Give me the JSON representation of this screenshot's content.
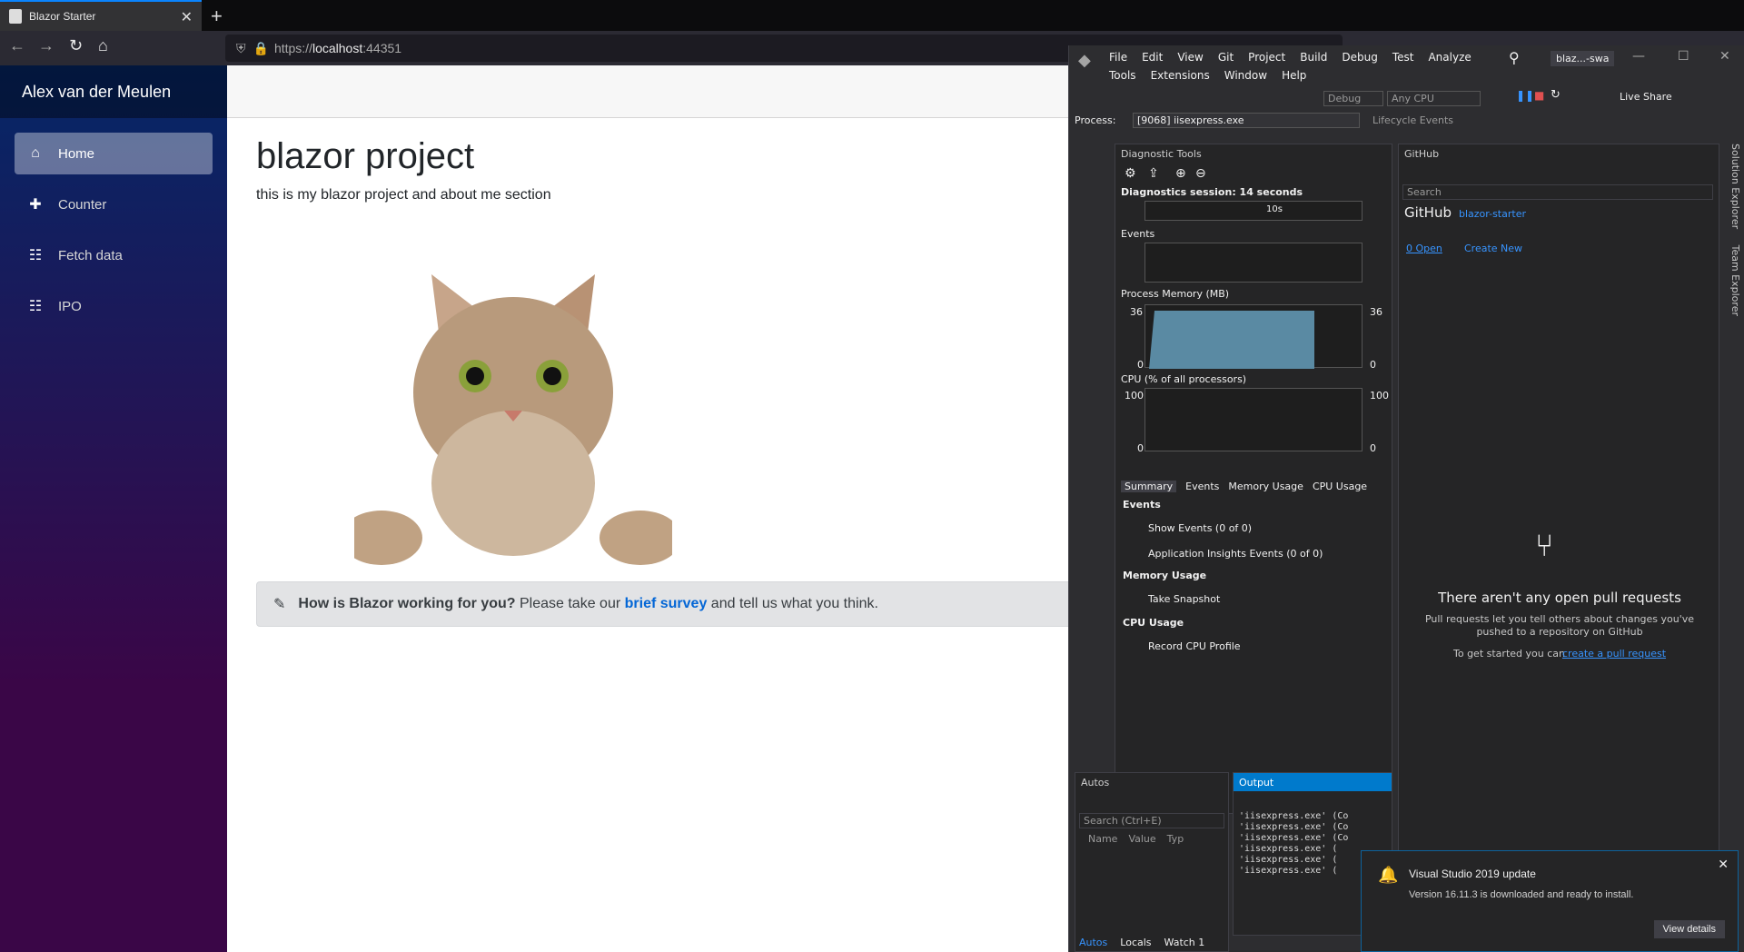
{
  "browser": {
    "tab_title": "Blazor Starter",
    "url_scheme": "https://",
    "url_host": "localhost",
    "url_port": ":44351"
  },
  "sidebar": {
    "brand": "Alex van der Meulen",
    "items": [
      {
        "label": "Home",
        "icon": "home-icon",
        "active": true
      },
      {
        "label": "Counter",
        "icon": "plus-icon",
        "active": false
      },
      {
        "label": "Fetch data",
        "icon": "list-icon",
        "active": false
      },
      {
        "label": "IPO",
        "icon": "list-icon",
        "active": false
      }
    ]
  },
  "main": {
    "title": "blazor project",
    "subtitle": "this is my blazor project and about me section",
    "survey_bold": "How is Blazor working for you?",
    "survey_text_1": "Please take our",
    "survey_link": "brief survey",
    "survey_text_2": "and tell us what you think."
  },
  "vs": {
    "menu_row1": [
      "File",
      "Edit",
      "View",
      "Git",
      "Project",
      "Build",
      "Debug",
      "Test",
      "Analyze"
    ],
    "menu_row2": [
      "Tools",
      "Extensions",
      "Window",
      "Help"
    ],
    "solution": "blaz...-swa",
    "process_label": "Process:",
    "process_value": "[9068] iisexpress.exe",
    "lifecycle": "Lifecycle Events",
    "debug_config": "Debug",
    "platform": "Any CPU",
    "live_share": "Live Share",
    "diag": {
      "title": "Diagnostic Tools",
      "session": "Diagnostics session: 14 seconds",
      "timeline_tick": "10s",
      "events_label": "Events",
      "memory_label": "Process Memory (MB)",
      "memory_max": "36",
      "memory_min": "0",
      "cpu_label": "CPU (% of all processors)",
      "cpu_max": "100",
      "cpu_min": "0",
      "tabs": [
        "Summary",
        "Events",
        "Memory Usage",
        "CPU Usage"
      ],
      "events_section": "Events",
      "show_events": "Show Events (0 of 0)",
      "app_insights": "Application Insights Events (0 of 0)",
      "memory_section": "Memory Usage",
      "take_snapshot": "Take Snapshot",
      "cpu_section": "CPU Usage",
      "record_cpu": "Record CPU Profile"
    },
    "github": {
      "title": "GitHub",
      "search_placeholder": "Search",
      "brand": "GitHub",
      "repo": "blazor-starter",
      "open": "0 Open",
      "create_new": "Create New",
      "no_pr": "There aren't any open pull requests",
      "pr_desc_1": "Pull requests let you tell others about changes you've",
      "pr_desc_2": "pushed to a repository on GitHub",
      "get_started": "To get started you can",
      "create_pr_link": "create a pull request"
    },
    "side_tabs": [
      "Solution Explorer",
      "Team Explorer"
    ],
    "autos": {
      "title": "Autos",
      "search": "Search (Ctrl+E)",
      "cols": [
        "Name",
        "Value",
        "Typ"
      ],
      "bottom_tabs": [
        "Autos",
        "Locals",
        "Watch 1"
      ]
    },
    "output": {
      "title": "Output",
      "lines": [
        "'iisexpress.exe' (Co",
        "'iisexpress.exe' (Co",
        "'iisexpress.exe' (Co",
        "'iisexpress.exe' (",
        "'iisexpress.exe' (",
        "'iisexpress.exe' ("
      ]
    },
    "notification": {
      "title": "Visual Studio 2019 update",
      "body": "Version 16.11.3 is downloaded and ready to install.",
      "button": "View details"
    }
  }
}
